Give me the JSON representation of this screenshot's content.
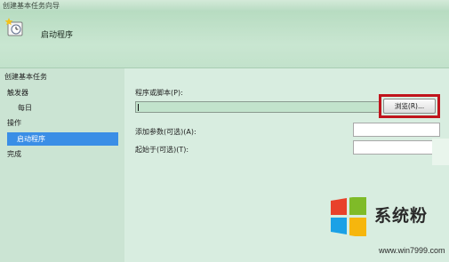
{
  "window": {
    "title": "创建基本任务向导"
  },
  "header": {
    "title": "启动程序"
  },
  "sidebar": {
    "items": [
      {
        "label": "创建基本任务"
      },
      {
        "label": "触发器"
      },
      {
        "label": "每日"
      },
      {
        "label": "操作"
      },
      {
        "label": "启动程序"
      },
      {
        "label": "完成"
      }
    ]
  },
  "form": {
    "program_label": "程序或脚本(P):",
    "program_value": "",
    "browse_label": "浏览(R)...",
    "args_label": "添加参数(可选)(A):",
    "args_value": "",
    "startin_label": "起始于(可选)(T):",
    "startin_value": ""
  },
  "watermark": {
    "brand": "系统粉",
    "url": "www.win7999.com",
    "logo_icon": "windows-logo-icon"
  },
  "colors": {
    "selection": "#3a8ee6",
    "highlight": "#c0141c",
    "header_bg": "#b7dcc1"
  }
}
